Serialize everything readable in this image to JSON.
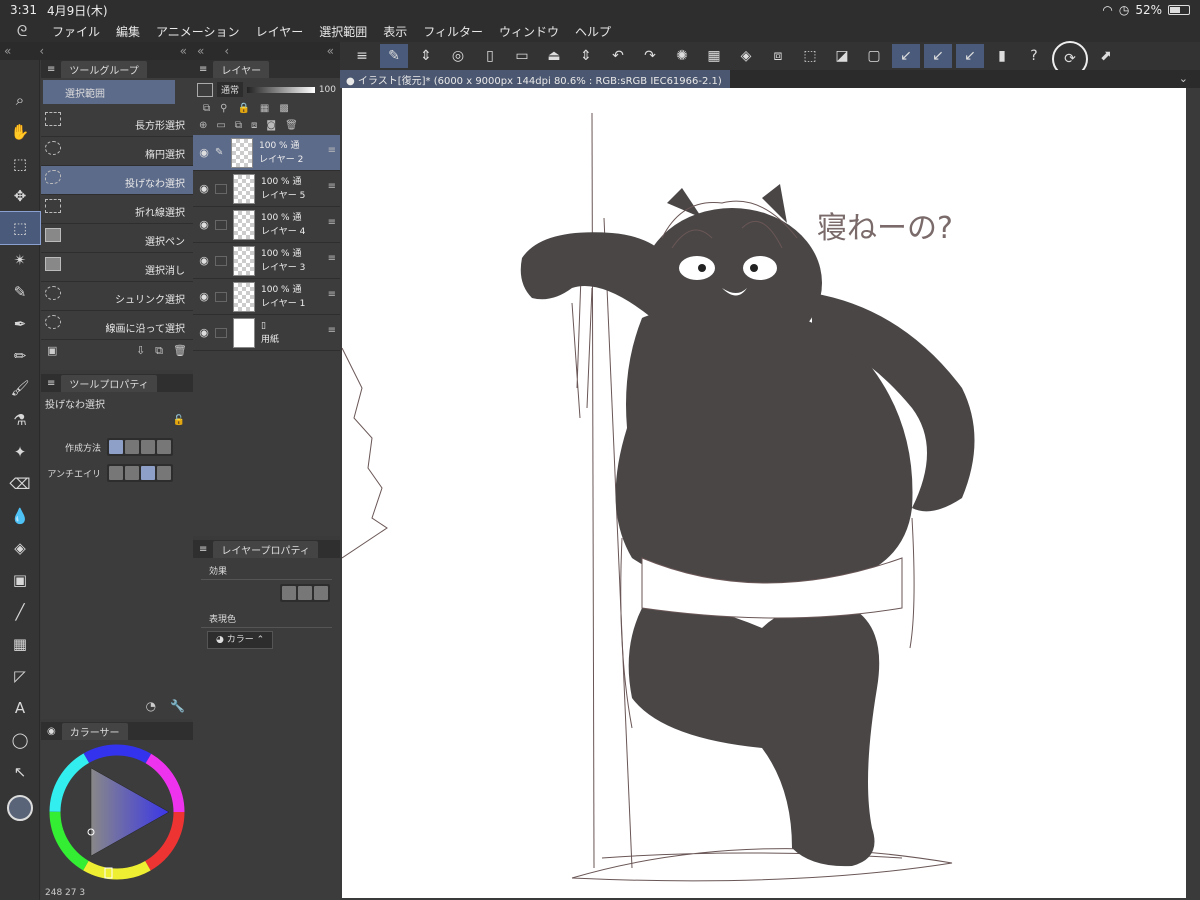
{
  "status": {
    "time": "3:31",
    "date": "4月9日(木)",
    "battery": "52%"
  },
  "menu": [
    "ファイル",
    "編集",
    "アニメーション",
    "レイヤー",
    "選択範囲",
    "表示",
    "フィルター",
    "ウィンドウ",
    "ヘルプ"
  ],
  "tool_group": {
    "title": "ツールグループ",
    "top_item": "選択範囲",
    "items": [
      {
        "label": "長方形選択"
      },
      {
        "label": "楕円選択"
      },
      {
        "label": "投げなわ選択"
      },
      {
        "label": "折れ線選択"
      },
      {
        "label": "選択ペン"
      },
      {
        "label": "選択消し"
      },
      {
        "label": "シュリンク選択"
      },
      {
        "label": "線画に沿って選択"
      }
    ]
  },
  "tool_property": {
    "title": "ツールプロパティ",
    "tool_name": "投げなわ選択",
    "mode_label": "作成方法",
    "antialias_label": "アンチエイリ"
  },
  "color_panel": {
    "title": "カラーサー",
    "values": "248  27  3"
  },
  "layer_panel": {
    "title": "レイヤー",
    "blend": "通常",
    "opacity": "100",
    "layers": [
      {
        "opacity": "100 %",
        "mode": "通",
        "name": "レイヤー 2"
      },
      {
        "opacity": "100 %",
        "mode": "通",
        "name": "レイヤー 5"
      },
      {
        "opacity": "100 %",
        "mode": "通",
        "name": "レイヤー 4"
      },
      {
        "opacity": "100 %",
        "mode": "通",
        "name": "レイヤー 3"
      },
      {
        "opacity": "100 %",
        "mode": "通",
        "name": "レイヤー 1"
      },
      {
        "opacity": "",
        "mode": "",
        "name": "用紙"
      }
    ]
  },
  "layer_property": {
    "title": "レイヤープロパティ",
    "effect_label": "効果",
    "color_label": "表現色",
    "color_value": "カラー"
  },
  "document": {
    "tab": "イラスト[復元]* (6000 x 9000px 144dpi 80.6% : RGB:sRGB IEC61966-2.1)",
    "speech_text": "寝ねーの?"
  },
  "colors": {
    "accent": "#5d6b8a",
    "panel": "#3c3c3c",
    "ink": "#4a4646"
  }
}
